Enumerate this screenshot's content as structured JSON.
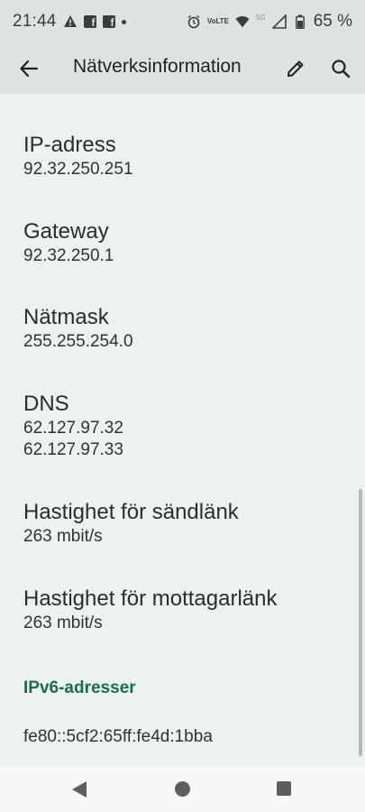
{
  "status_bar": {
    "time": "21:44",
    "network_label": "5G",
    "volte_label": "VoLTE",
    "battery_percent": "65 %"
  },
  "app_bar": {
    "title": "Nätverksinformation",
    "back_icon": "arrow-back-icon",
    "edit_icon": "pencil-icon",
    "search_icon": "search-icon"
  },
  "items": [
    {
      "label": "IP-adress",
      "values": [
        "92.32.250.251"
      ]
    },
    {
      "label": "Gateway",
      "values": [
        "92.32.250.1"
      ]
    },
    {
      "label": "Nätmask",
      "values": [
        "255.255.254.0"
      ]
    },
    {
      "label": "DNS",
      "values": [
        "62.127.97.32",
        "62.127.97.33"
      ]
    },
    {
      "label": "Hastighet för sändlänk",
      "values": [
        "263 mbit/s"
      ]
    },
    {
      "label": "Hastighet för mottagarlänk",
      "values": [
        "263 mbit/s"
      ]
    }
  ],
  "ipv6": {
    "header": "IPv6-adresser",
    "addresses": [
      "fe80::5cf2:65ff:fe4d:1bba"
    ]
  },
  "colors": {
    "accent": "#1a6b55",
    "app_bar_bg": "#dde3de",
    "content_bg": "#eef2ee"
  }
}
